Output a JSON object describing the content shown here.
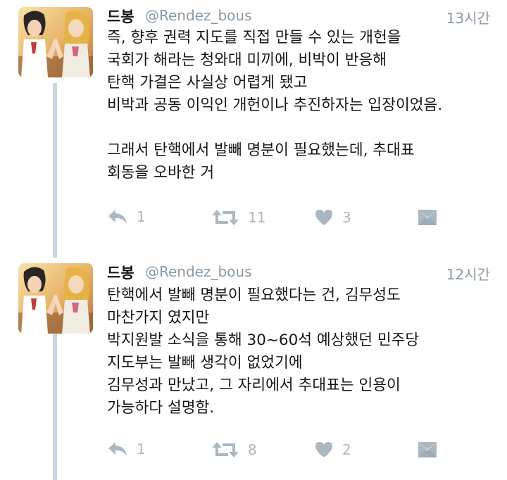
{
  "tweets": [
    {
      "name": "드봉",
      "handle": "@Rendez_bous",
      "time": "13시간",
      "lines": [
        "즉,  향후 권력 지도를 직접 만들 수 있는 개헌을",
        "국회가 해라는 청와대 미끼에, 비박이 반응해",
        "탄핵 가결은 사실상 어렵게 됐고",
        "비박과 공동 이익인 개헌이나 추진하자는 입장이었음.",
        "",
        "그래서 탄핵에서 발빼 명분이 필요했는데, 추대표",
        "회동을 오바한 거"
      ],
      "reply_count": "1",
      "retweet_count": "11",
      "like_count": "3"
    },
    {
      "name": "드봉",
      "handle": "@Rendez_bous",
      "time": "12시간",
      "lines": [
        "탄핵에서 발빼 명분이 필요했다는 건,  김무성도",
        "마찬가지 였지만",
        "박지원발 소식을 통해 30~60석 예상했던 민주당",
        "지도부는 발빼 생각이 없었기에",
        "김무성과 만났고, 그 자리에서 추대표는 인용이",
        "가능하다 설명함."
      ],
      "reply_count": "1",
      "retweet_count": "8",
      "like_count": "2"
    }
  ],
  "icons": {
    "reply": "reply-icon",
    "retweet": "retweet-icon",
    "like": "heart-icon",
    "dm": "envelope-icon"
  },
  "colors": {
    "icon_gray": "#aab8c2",
    "handle_gray": "#8899a6",
    "thread_line": "#ccd6dd",
    "text": "#14171a"
  }
}
